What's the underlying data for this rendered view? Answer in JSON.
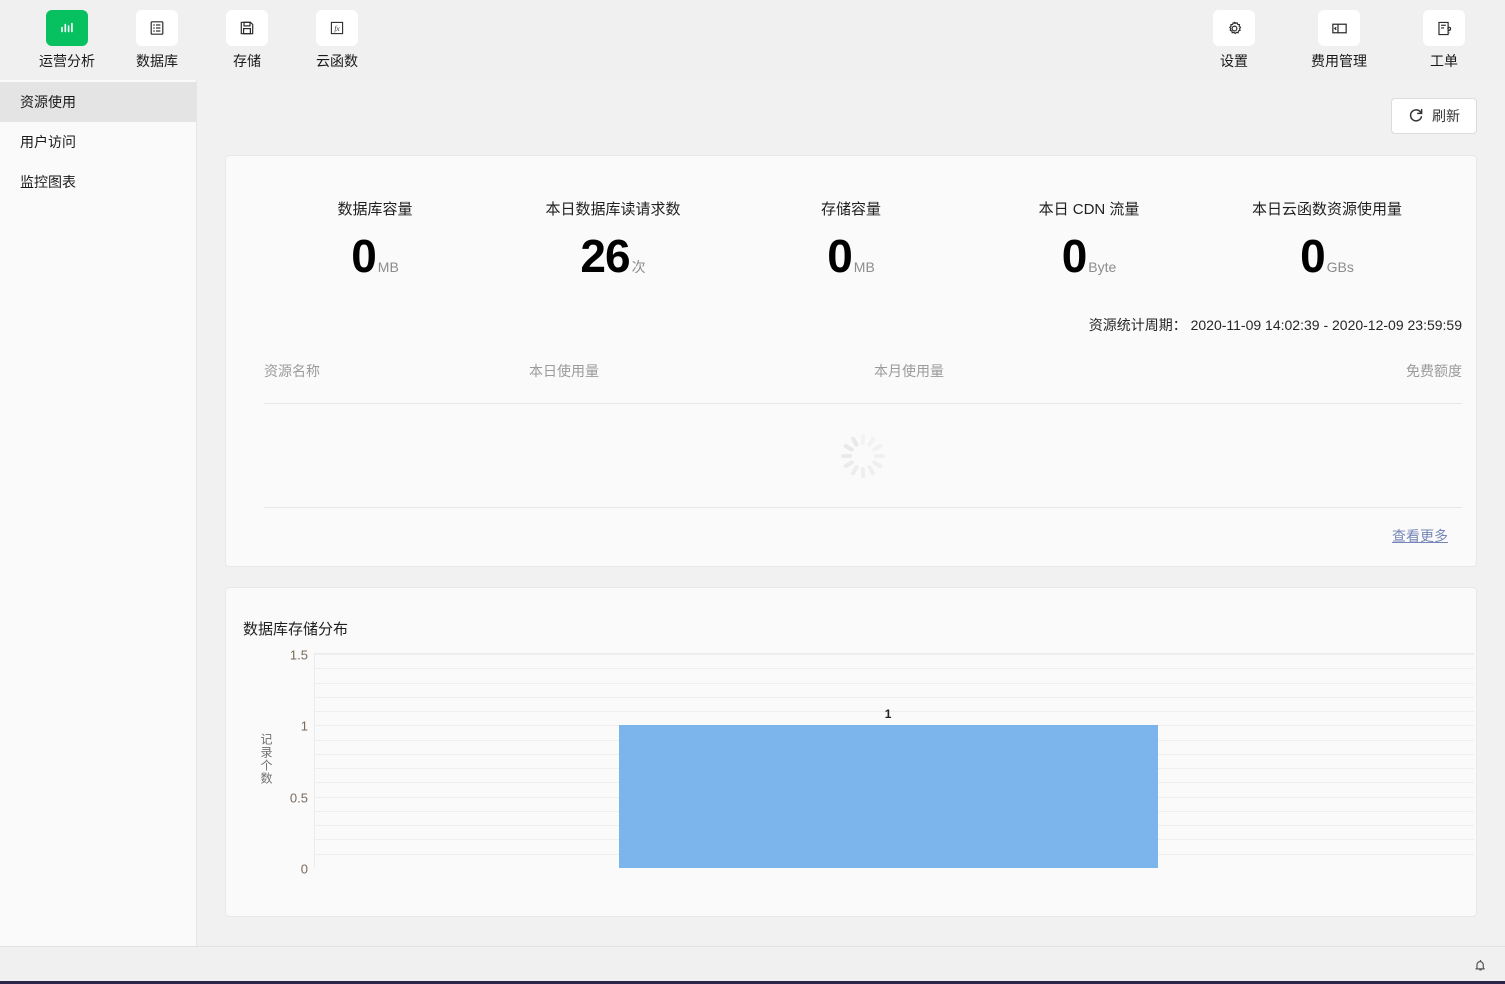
{
  "toolbar": {
    "left_items": [
      {
        "label": "运营分析",
        "icon": "bar-chart-icon",
        "active": true
      },
      {
        "label": "数据库",
        "icon": "database-list-icon",
        "active": false
      },
      {
        "label": "存储",
        "icon": "save-disk-icon",
        "active": false
      },
      {
        "label": "云函数",
        "icon": "function-fx-icon",
        "active": false
      }
    ],
    "right_items": [
      {
        "label": "设置",
        "icon": "gear-icon"
      },
      {
        "label": "费用管理",
        "icon": "billing-panel-icon"
      },
      {
        "label": "工单",
        "icon": "ticket-question-icon"
      }
    ]
  },
  "sidebar": {
    "items": [
      {
        "label": "资源使用",
        "active": true
      },
      {
        "label": "用户访问",
        "active": false
      },
      {
        "label": "监控图表",
        "active": false
      }
    ]
  },
  "main": {
    "refresh_label": "刷新",
    "refresh_icon": "refresh-icon",
    "stats": [
      {
        "title": "数据库容量",
        "value": "0",
        "unit": "MB"
      },
      {
        "title": "本日数据库读请求数",
        "value": "26",
        "unit": "次"
      },
      {
        "title": "存储容量",
        "value": "0",
        "unit": "MB"
      },
      {
        "title": "本日 CDN 流量",
        "value": "0",
        "unit": "Byte"
      },
      {
        "title": "本日云函数资源使用量",
        "value": "0",
        "unit": "GBs"
      }
    ],
    "period_text": "资源统计周期： 2020-11-09 14:02:39 - 2020-12-09 23:59:59",
    "table": {
      "headers": [
        "资源名称",
        "本日使用量",
        "本月使用量",
        "免费额度"
      ],
      "rows": [],
      "loading_icon": "loading-spinner-icon"
    },
    "more_label": "查看更多"
  },
  "chart_data": {
    "type": "bar",
    "title": "数据库存储分布",
    "xlabel": "",
    "ylabel": "记录个数",
    "categories": [
      ""
    ],
    "values": [
      1
    ],
    "data_labels": [
      "1"
    ],
    "ylim": [
      0,
      1.5
    ],
    "yticks": [
      1.5,
      1,
      0.5,
      0
    ],
    "ytick_labels": [
      "1.5",
      "1",
      "0.5",
      "0"
    ],
    "grid": true,
    "legend": false,
    "bar_color": "#7cb5ec"
  },
  "statusbar": {
    "bell_icon": "bell-icon"
  }
}
